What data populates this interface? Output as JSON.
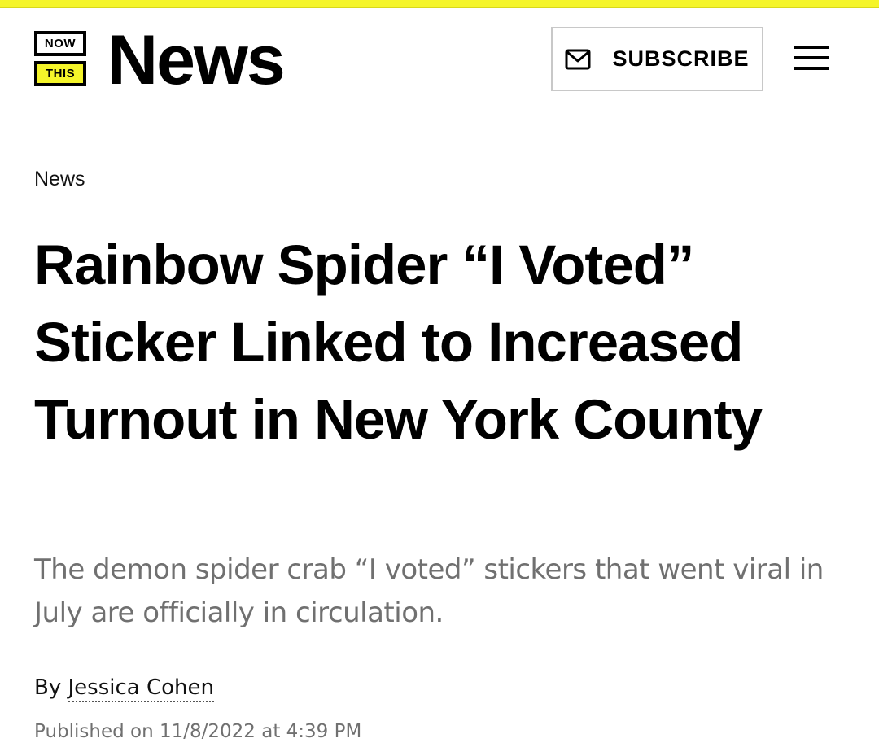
{
  "header": {
    "logo_top": "NOW",
    "logo_bottom": "THIS",
    "site_name": "News",
    "subscribe_label": "SUBSCRIBE",
    "subscribe_icon": "mail-icon",
    "menu_icon": "hamburger-menu-icon"
  },
  "article": {
    "category": "News",
    "headline": "Rainbow Spider “I Voted” Sticker Linked to Increased Turnout in New York County",
    "dek": "The demon spider crab “I voted” stickers that went viral in July are officially in circulation.",
    "byline_prefix": "By",
    "author": "Jessica Cohen",
    "published": "Published on 11/8/2022 at 4:39 PM"
  },
  "colors": {
    "accent_yellow": "#f5f52a",
    "text": "#000000",
    "muted_text": "#707070",
    "border": "#c8c8c8"
  }
}
